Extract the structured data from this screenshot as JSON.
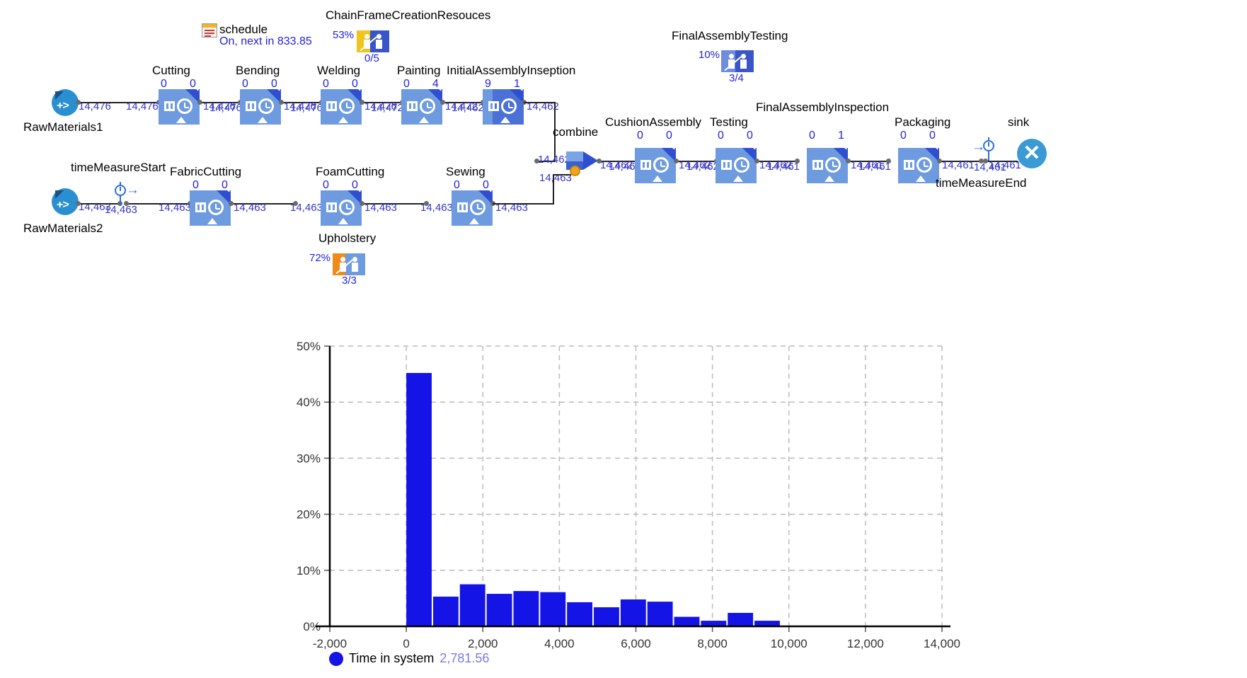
{
  "model": {
    "schedule": {
      "icon": "schedule-icon",
      "label": "schedule",
      "status": "On, next in 833.85"
    },
    "resource_pools": [
      {
        "name": "ChainFrameCreationResouces",
        "utilization": "53%",
        "counts": "0/5",
        "busy_color": "#f0c41b",
        "idle_color": "#3a55c8",
        "busy_fraction": 0.53
      },
      {
        "name": "FinalAssemblyTesting",
        "utilization": "10%",
        "counts": "3/4",
        "busy_color": "#6e8ce0",
        "idle_color": "#3a55c8",
        "busy_fraction": 0.45
      },
      {
        "name": "Upholstery",
        "utilization": "72%",
        "counts": "3/3",
        "busy_color": "#f08a18",
        "idle_color": "#6e9be0",
        "busy_fraction": 0.4
      }
    ],
    "sources": [
      {
        "name": "RawMaterials1",
        "out": "14,476"
      },
      {
        "name": "RawMaterials2",
        "out": "14,463"
      }
    ],
    "sink": {
      "name": "sink",
      "in": "14,461"
    },
    "time_measure_start": {
      "name": "timeMeasureStart",
      "in": "14,463",
      "out": "14,463"
    },
    "time_measure_end": {
      "name": "timeMeasureEnd",
      "in": "14,461",
      "out": "14,461"
    },
    "combine": {
      "name": "combine",
      "in_top": "14,462",
      "in_bottom": "14,463",
      "out": "14,462"
    },
    "blocks_top": [
      {
        "name": "Cutting",
        "queue": "0",
        "busy": "0",
        "in": "14,476",
        "out": "14,476",
        "fill": 0.0
      },
      {
        "name": "Bending",
        "queue": "0",
        "busy": "0",
        "in": "14,476",
        "out": "14,476",
        "fill": 0.0
      },
      {
        "name": "Welding",
        "queue": "0",
        "busy": "0",
        "in": "14,476",
        "out": "14,476",
        "fill": 0.0
      },
      {
        "name": "Painting",
        "queue": "0",
        "busy": "4",
        "in": "14,472",
        "out": "14,472",
        "fill": 0.0
      },
      {
        "name": "InitialAssemblyInseption",
        "queue": "9",
        "busy": "1",
        "in": "14,462",
        "out": "14,462",
        "fill": 0.62
      }
    ],
    "blocks_bottom": [
      {
        "name": "FabricCutting",
        "queue": "0",
        "busy": "0",
        "in": "14,463",
        "out": "14,463",
        "fill": 0.0
      },
      {
        "name": "FoamCutting",
        "queue": "0",
        "busy": "0",
        "in": "14,463",
        "out": "14,463",
        "fill": 0.0
      },
      {
        "name": "Sewing",
        "queue": "0",
        "busy": "0",
        "in": "14,463",
        "out": "14,463",
        "fill": 0.0
      }
    ],
    "blocks_right": [
      {
        "name": "CushionAssembly",
        "queue": "0",
        "busy": "0",
        "in": "14,462",
        "out": "14,462",
        "fill": 0.0
      },
      {
        "name": "Testing",
        "queue": "0",
        "busy": "0",
        "in": "14,462",
        "out": "14,462",
        "fill": 0.0
      },
      {
        "name": "FinalAssemblyInspection",
        "queue": "0",
        "busy": "1",
        "in": "14,461",
        "out": "14,461",
        "fill": 0.0
      },
      {
        "name": "Packaging",
        "queue": "0",
        "busy": "0",
        "in": "14,461",
        "out": "14,461",
        "fill": 0.0
      }
    ]
  },
  "chart_data": {
    "type": "bar",
    "title": "",
    "xlabel": "",
    "ylabel": "",
    "grid": true,
    "legend_position": "bottom-left",
    "bar_color": "#1414e6",
    "xlim": [
      -2000,
      14000
    ],
    "ylim": [
      0,
      0.5
    ],
    "xticks": [
      "-2,000",
      "0",
      "2,000",
      "4,000",
      "6,000",
      "8,000",
      "10,000",
      "12,000",
      "14,000"
    ],
    "xtick_values": [
      -2000,
      0,
      2000,
      4000,
      6000,
      8000,
      10000,
      12000,
      14000
    ],
    "yticks": [
      "0%",
      "10%",
      "20%",
      "30%",
      "40%",
      "50%"
    ],
    "ytick_values": [
      0,
      0.1,
      0.2,
      0.3,
      0.4,
      0.5
    ],
    "bin_width": 700,
    "bin_starts": [
      0,
      700,
      1400,
      2100,
      2800,
      3500,
      4200,
      4900,
      5600,
      6300,
      7000,
      7700,
      8400,
      9100,
      9800,
      10500
    ],
    "values": [
      0.452,
      0.053,
      0.075,
      0.058,
      0.063,
      0.061,
      0.043,
      0.034,
      0.048,
      0.044,
      0.017,
      0.01,
      0.024,
      0.01
    ],
    "series": [
      {
        "name": "Time in system",
        "values": [
          0.452,
          0.053,
          0.075,
          0.058,
          0.063,
          0.061,
          0.043,
          0.034,
          0.048,
          0.044,
          0.017,
          0.01,
          0.024,
          0.01
        ]
      }
    ],
    "legend": [
      {
        "label": "Time in system",
        "value": "2,781.56",
        "color": "#1414e6"
      }
    ]
  }
}
